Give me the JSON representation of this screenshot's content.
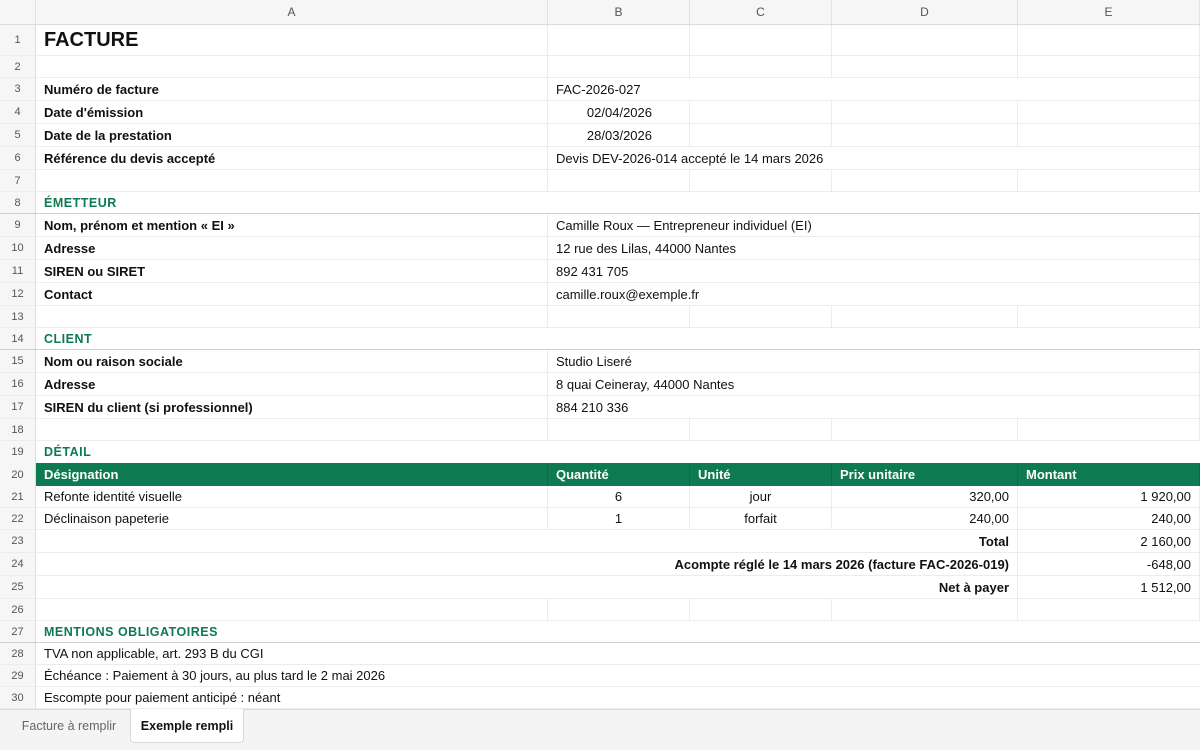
{
  "columns": [
    "A",
    "B",
    "C",
    "D",
    "E"
  ],
  "rows": {
    "r1": {
      "num": "1",
      "title": "FACTURE"
    },
    "r2": {
      "num": "2"
    },
    "r3": {
      "num": "3",
      "label": "Numéro de facture",
      "value": "FAC-2026-027"
    },
    "r4": {
      "num": "4",
      "label": "Date d'émission",
      "value": "02/04/2026"
    },
    "r5": {
      "num": "5",
      "label": "Date de la prestation",
      "value": "28/03/2026"
    },
    "r6": {
      "num": "6",
      "label": "Référence du devis accepté",
      "value": "Devis DEV-2026-014 accepté le 14 mars 2026"
    },
    "r7": {
      "num": "7"
    },
    "r8": {
      "num": "8",
      "section": "ÉMETTEUR"
    },
    "r9": {
      "num": "9",
      "label": "Nom, prénom et mention « EI »",
      "value": "Camille Roux — Entrepreneur individuel (EI)"
    },
    "r10": {
      "num": "10",
      "label": "Adresse",
      "value": "12 rue des Lilas, 44000 Nantes"
    },
    "r11": {
      "num": "11",
      "label": "SIREN ou SIRET",
      "value": "892 431 705"
    },
    "r12": {
      "num": "12",
      "label": "Contact",
      "value": "camille.roux@exemple.fr"
    },
    "r13": {
      "num": "13"
    },
    "r14": {
      "num": "14",
      "section": "CLIENT"
    },
    "r15": {
      "num": "15",
      "label": "Nom ou raison sociale",
      "value": "Studio Liseré"
    },
    "r16": {
      "num": "16",
      "label": "Adresse",
      "value": "8 quai Ceineray, 44000 Nantes"
    },
    "r17": {
      "num": "17",
      "label": "SIREN du client (si professionnel)",
      "value": "884 210 336"
    },
    "r18": {
      "num": "18"
    },
    "r19": {
      "num": "19",
      "section": "DÉTAIL"
    },
    "r20": {
      "num": "20",
      "h1": "Désignation",
      "h2": "Quantité",
      "h3": "Unité",
      "h4": "Prix unitaire",
      "h5": "Montant"
    },
    "r21": {
      "num": "21",
      "designation": "Refonte identité visuelle",
      "quantite": "6",
      "unite": "jour",
      "prix": "320,00",
      "montant": "1 920,00"
    },
    "r22": {
      "num": "22",
      "designation": "Déclinaison papeterie",
      "quantite": "1",
      "unite": "forfait",
      "prix": "240,00",
      "montant": "240,00"
    },
    "r23": {
      "num": "23",
      "label": "Total",
      "value": "2 160,00"
    },
    "r24": {
      "num": "24",
      "label": "Acompte réglé le 14 mars 2026 (facture FAC-2026-019)",
      "value": "-648,00"
    },
    "r25": {
      "num": "25",
      "label": "Net à payer",
      "value": "1 512,00"
    },
    "r26": {
      "num": "26"
    },
    "r27": {
      "num": "27",
      "section": "MENTIONS OBLIGATOIRES"
    },
    "r28": {
      "num": "28",
      "text": "TVA non applicable, art. 293 B du CGI"
    },
    "r29": {
      "num": "29",
      "text": "Échéance : Paiement à 30 jours, au plus tard le 2 mai 2026"
    },
    "r30": {
      "num": "30",
      "text": "Escompte pour paiement anticipé : néant"
    }
  },
  "tabs": [
    "Facture à remplir",
    "Exemple rempli"
  ],
  "colors": {
    "accent": "#0e7a52",
    "section_text": "#0f7a50"
  }
}
